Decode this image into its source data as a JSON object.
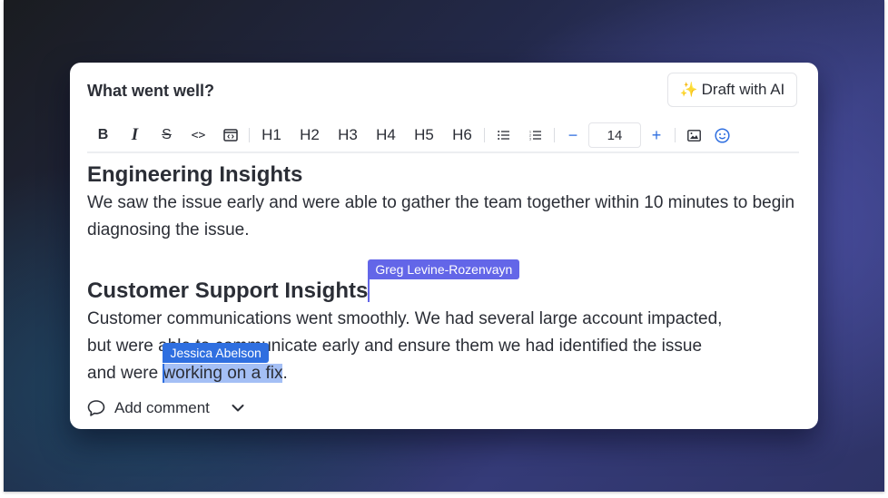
{
  "card": {
    "title": "What went well?",
    "ai_button": {
      "icon": "sparkles-icon",
      "icon_glyph": "✨",
      "label": "Draft with AI"
    }
  },
  "toolbar": {
    "format_buttons": [
      {
        "name": "bold",
        "glyph": "B"
      },
      {
        "name": "italic",
        "glyph": "I"
      },
      {
        "name": "strikethrough",
        "glyph": "S"
      },
      {
        "name": "inline-code",
        "glyph": "<>"
      },
      {
        "name": "code-block",
        "glyph": "<>"
      }
    ],
    "headings": [
      "H1",
      "H2",
      "H3",
      "H4",
      "H5",
      "H6"
    ],
    "lists": [
      {
        "name": "bullet-list",
        "glyph": "☰"
      },
      {
        "name": "numbered-list",
        "glyph": "☰"
      }
    ],
    "font_size": {
      "decrease": "−",
      "value": "14",
      "increase": "+"
    },
    "insert": [
      {
        "name": "image",
        "glyph": "🖼"
      },
      {
        "name": "emoji",
        "glyph": "☺"
      }
    ]
  },
  "editor": {
    "section1": {
      "heading": "Engineering Insights",
      "body": "We saw the issue early and were able to gather the team together within 10 minutes to begin diagnosing the issue."
    },
    "section2": {
      "heading": "Customer Support Insights",
      "body_line1": "Customer communications went smoothly. We had several large account impacted,",
      "body_line2_prefix": "but were ",
      "body_line2_rest": "able to communicate early and ensure them we had identified the issue",
      "body_line3_prefix": "and were ",
      "body_selected": "working on a fix",
      "body_line3_suffix": "."
    },
    "collaborators": [
      {
        "name": "Greg Levine-Rozenvayn",
        "color": "#6366e8"
      },
      {
        "name": "Jessica Abelson",
        "color": "#2f6fe0"
      }
    ]
  },
  "footer": {
    "add_comment_label": "Add comment",
    "comment_icon": "speech-bubble-icon",
    "chevron_icon": "chevron-down-icon"
  }
}
